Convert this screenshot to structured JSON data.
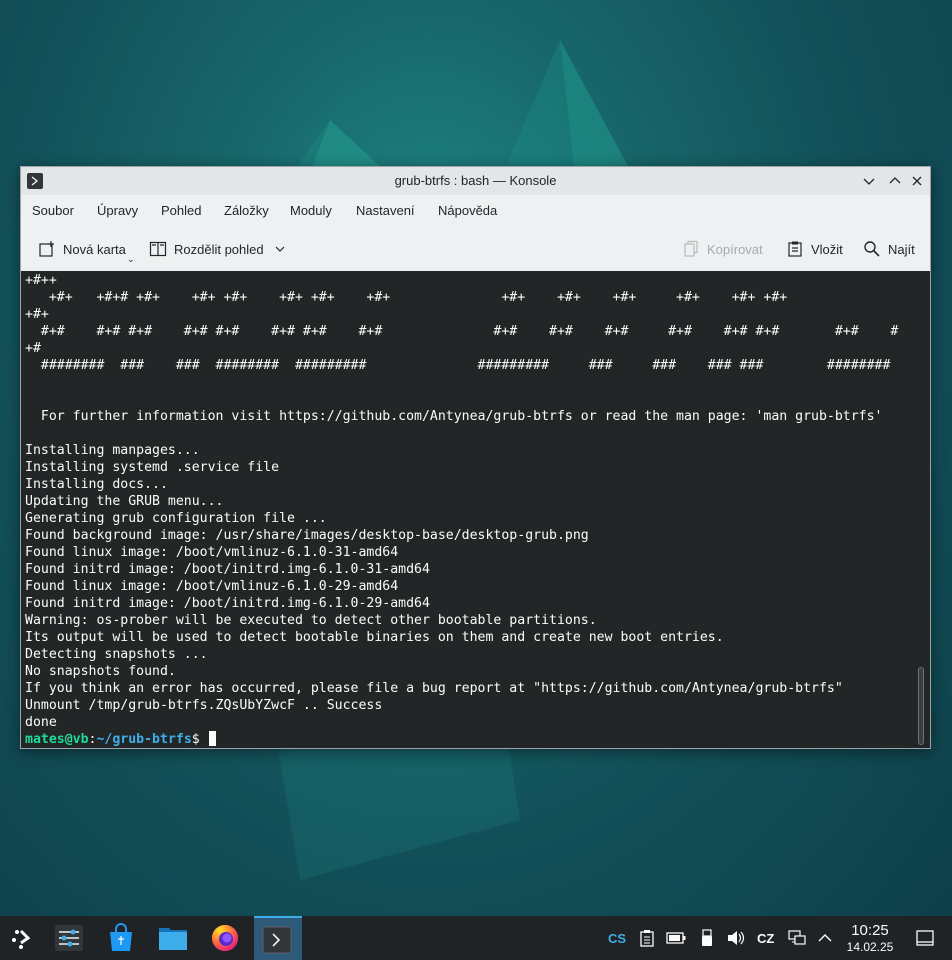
{
  "window": {
    "title": "grub-btrfs : bash — Konsole",
    "menu": [
      "Soubor",
      "Úpravy",
      "Pohled",
      "Záložky",
      "Moduly",
      "Nastavení",
      "Nápověda"
    ],
    "toolbar": {
      "new_tab": "Nová karta",
      "split_view": "Rozdělit pohled",
      "copy": "Kopírovat",
      "paste": "Vložit",
      "find": "Najít"
    }
  },
  "terminal": {
    "lines": [
      "+#++",
      "   +#+   +#+# +#+    +#+ +#+    +#+ +#+    +#+              +#+    +#+    +#+     +#+    +#+ +#+",
      "+#+",
      "  #+#    #+# #+#    #+# #+#    #+# #+#    #+#              #+#    #+#    #+#     #+#    #+# #+#       #+#    #",
      "+#",
      "  ########  ###    ###  ########  #########              #########     ###     ###    ### ###        ########",
      "",
      "",
      "  For further information visit https://github.com/Antynea/grub-btrfs or read the man page: 'man grub-btrfs'",
      "",
      "Installing manpages...",
      "Installing systemd .service file",
      "Installing docs...",
      "Updating the GRUB menu...",
      "Generating grub configuration file ...",
      "Found background image: /usr/share/images/desktop-base/desktop-grub.png",
      "Found linux image: /boot/vmlinuz-6.1.0-31-amd64",
      "Found initrd image: /boot/initrd.img-6.1.0-31-amd64",
      "Found linux image: /boot/vmlinuz-6.1.0-29-amd64",
      "Found initrd image: /boot/initrd.img-6.1.0-29-amd64",
      "Warning: os-prober will be executed to detect other bootable partitions.",
      "Its output will be used to detect bootable binaries on them and create new boot entries.",
      "Detecting snapshots ...",
      "No snapshots found.",
      "If you think an error has occurred, please file a bug report at \"https://github.com/Antynea/grub-btrfs\"",
      "Unmount /tmp/grub-btrfs.ZQsUbYZwcF .. Success",
      "done"
    ],
    "prompt": {
      "user_host": "mates@vb",
      "separator": ":",
      "path": "~/grub-btrfs",
      "symbol": "$ "
    }
  },
  "taskbar": {
    "apps": [
      "app-launcher-icon",
      "system-settings-icon",
      "discover-store-icon",
      "dolphin-files-icon",
      "firefox-icon",
      "konsole-icon"
    ],
    "tray": {
      "lang_indicator": "CS",
      "keyboard_layout": "CZ"
    },
    "clock": {
      "time": "10:25",
      "date": "14.02.25"
    }
  },
  "colors": {
    "terminal_bg": "#232627",
    "terminal_fg": "#fcfcfc",
    "prompt_user": "#1cdc9a",
    "prompt_path": "#3daee9",
    "accent": "#3daee9"
  }
}
